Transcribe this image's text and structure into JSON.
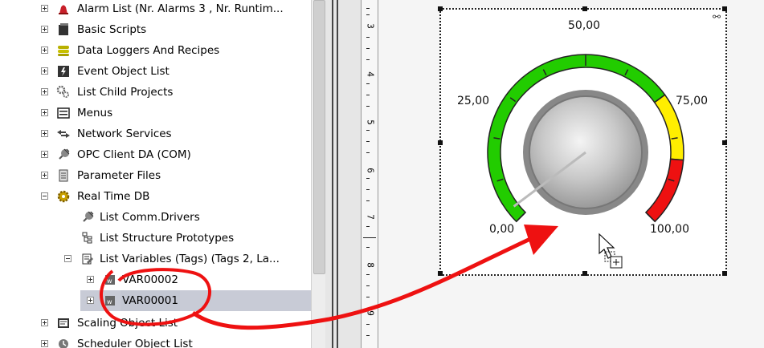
{
  "tree": {
    "items": [
      {
        "label": "Alarm List (Nr. Alarms  3 , Nr. Runtim...",
        "icon": "alarm-bell-icon"
      },
      {
        "label": "Basic Scripts",
        "icon": "script-icon"
      },
      {
        "label": "Data Loggers And Recipes",
        "icon": "database-icon"
      },
      {
        "label": "Event Object List",
        "icon": "event-icon"
      },
      {
        "label": "List Child Projects",
        "icon": "gears-icon"
      },
      {
        "label": "Menus",
        "icon": "menu-icon"
      },
      {
        "label": "Network Services",
        "icon": "network-arrows-icon"
      },
      {
        "label": "OPC Client DA (COM)",
        "icon": "plug-icon"
      },
      {
        "label": "Parameter Files",
        "icon": "file-icon"
      },
      {
        "label": "Real Time DB",
        "icon": "gear-icon"
      },
      {
        "label": "List Comm.Drivers",
        "icon": "plug-icon"
      },
      {
        "label": "List Structure Prototypes",
        "icon": "structure-icon"
      },
      {
        "label": "List Variables (Tags) (Tags 2, La...",
        "icon": "variables-list-icon"
      },
      {
        "label": "VAR00002",
        "icon": "variable-icon"
      },
      {
        "label": "VAR00001",
        "icon": "variable-icon"
      },
      {
        "label": "Scaling Object List",
        "icon": "scaling-icon"
      },
      {
        "label": "Scheduler Object List",
        "icon": "scheduler-icon"
      }
    ]
  },
  "ruler": {
    "marks": [
      "3",
      "4",
      "5",
      "6",
      "7",
      "8",
      "9"
    ]
  },
  "gauge": {
    "scale_labels": {
      "min": "0,00",
      "q1": "25,00",
      "mid": "50,00",
      "q3": "75,00",
      "max": "100,00"
    },
    "value": 0,
    "range_min": 0,
    "range_max": 100,
    "green_range": [
      0,
      70
    ],
    "yellow_range": [
      70,
      85
    ],
    "red_range": [
      85,
      100
    ],
    "colors": {
      "green": "#22cc00",
      "yellow": "#ffee00",
      "red": "#ee1111",
      "annotation": "#ee1111"
    }
  }
}
